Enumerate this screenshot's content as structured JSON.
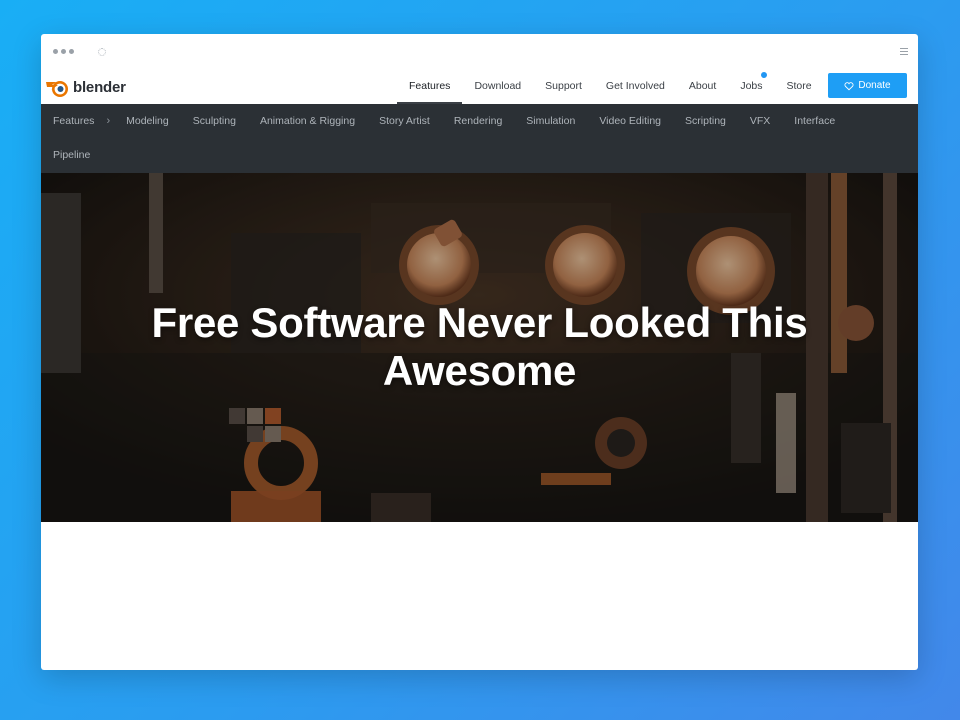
{
  "browser": {},
  "nav": {
    "logo_text": "blender",
    "links": [
      "Features",
      "Download",
      "Support",
      "Get Involved",
      "About",
      "Jobs",
      "Store"
    ],
    "donate_label": "Donate",
    "accent_color": "#1e9ef5"
  },
  "subnav": {
    "root": "Features",
    "row1": [
      "Modeling",
      "Sculpting",
      "Animation & Rigging",
      "Story Artist",
      "Rendering",
      "Simulation",
      "Video Editing",
      "Scripting",
      "VFX",
      "Interface"
    ],
    "row2": [
      "Pipeline"
    ]
  },
  "hero": {
    "title_line1": "Free Software Never Looked This",
    "title_line2": "Awesome"
  }
}
